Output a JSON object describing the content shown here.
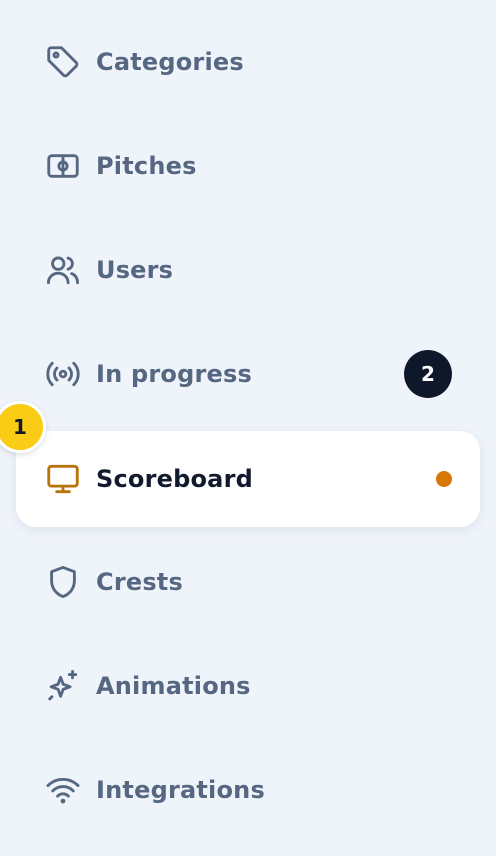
{
  "sidebar": {
    "items": [
      {
        "label": "Categories",
        "icon": "tag-icon"
      },
      {
        "label": "Pitches",
        "icon": "pitch-icon"
      },
      {
        "label": "Users",
        "icon": "users-icon"
      },
      {
        "label": "In progress",
        "icon": "broadcast-icon",
        "badge": "2"
      },
      {
        "label": "Scoreboard",
        "icon": "monitor-icon",
        "active": true,
        "indicator": "orange-dot"
      },
      {
        "label": "Crests",
        "icon": "shield-icon"
      },
      {
        "label": "Animations",
        "icon": "sparkles-icon"
      },
      {
        "label": "Integrations",
        "icon": "wifi-icon"
      }
    ],
    "step_badge": "1"
  },
  "colors": {
    "background": "#eff3fa",
    "inactive_text": "#566781",
    "active_text": "#121a2d",
    "active_icon": "#b8740a",
    "count_badge_bg": "#0f172a",
    "indicator_dot": "#d97706",
    "step_badge_bg": "#facc15"
  }
}
